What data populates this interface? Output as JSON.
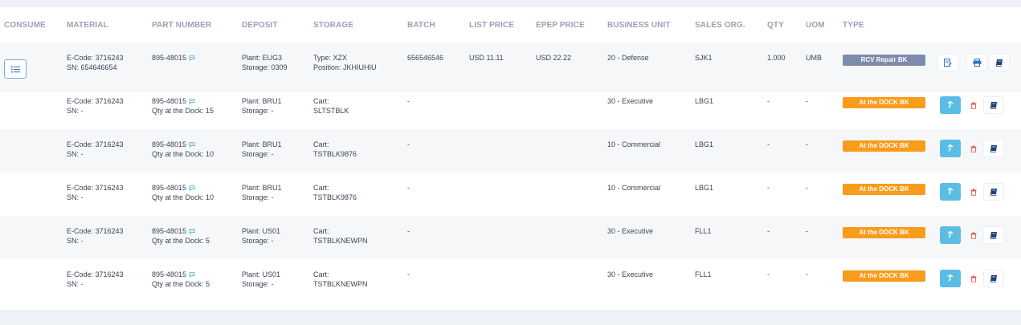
{
  "headers": {
    "consume": "CONSUME",
    "material": "MATERIAL",
    "part_number": "PART NUMBER",
    "deposit": "DEPOSIT",
    "storage": "STORAGE",
    "batch": "BATCH",
    "list_price": "LIST PRICE",
    "epep_price": "EPEP PRICE",
    "business_unit": "BUSINESS UNIT",
    "sales_org": "SALES ORG.",
    "qty": "QTY",
    "uom": "UOM",
    "type": "TYPE"
  },
  "colors": {
    "header_text": "#9aa3b2",
    "badge_grey": "#7d8cac",
    "badge_orange": "#f99b1b",
    "action_blue": "#5bbde3",
    "link_blue": "#3fa7dd",
    "delete_red": "#e25b5b"
  },
  "rows": [
    {
      "material_1": "E-Code: 3716243",
      "material_2": "SN: 654646654",
      "part_1": "895-48015",
      "part_2": "",
      "deposit_1": "Plant: EUG3",
      "deposit_2": "Storage: 0309",
      "storage_1": "Type: XZX",
      "storage_2": "Position: JKHIUHIU",
      "batch": "656546546",
      "list_price": "USD 11.11",
      "epep_price": "USD 22.22",
      "business_unit": "20 - Defense",
      "sales_org": "SJK1",
      "qty": "1.000",
      "uom": "UMB",
      "type": "RCV Repair BK",
      "icons": [
        "consume-list-icon",
        "edit-document-icon",
        "print-icon",
        "book-icon"
      ]
    },
    {
      "material_1": "E-Code: 3716243",
      "material_2": "SN: -",
      "part_1": "895-48015",
      "part_2": "Qty at the Dock: 15",
      "deposit_1": "Plant: BRU1",
      "deposit_2": "Storage: -",
      "storage_1": "Cart:",
      "storage_2": "SLTSTBLK",
      "batch": "-",
      "list_price": "",
      "epep_price": "",
      "business_unit": "30 - Executive",
      "sales_org": "LBG1",
      "qty": "-",
      "uom": "-",
      "type": "At the DOCK BK",
      "icons": [
        "move-icon",
        "trash-icon",
        "book-icon"
      ]
    },
    {
      "material_1": "E-Code: 3716243",
      "material_2": "SN: -",
      "part_1": "895-48015",
      "part_2": "Qty at the Dock: 10",
      "deposit_1": "Plant: BRU1",
      "deposit_2": "Storage: -",
      "storage_1": "Cart:",
      "storage_2": "TSTBLK9876",
      "batch": "-",
      "list_price": "",
      "epep_price": "",
      "business_unit": "10 - Commercial",
      "sales_org": "LBG1",
      "qty": "-",
      "uom": "-",
      "type": "At the DOCK BK",
      "icons": [
        "move-icon",
        "trash-icon",
        "book-icon"
      ]
    },
    {
      "material_1": "E-Code: 3716243",
      "material_2": "SN: -",
      "part_1": "895-48015",
      "part_2": "Qty at the Dock: 10",
      "deposit_1": "Plant: BRU1",
      "deposit_2": "Storage: -",
      "storage_1": "Cart:",
      "storage_2": "TSTBLK9876",
      "batch": "-",
      "list_price": "",
      "epep_price": "",
      "business_unit": "10 - Commercial",
      "sales_org": "LBG1",
      "qty": "-",
      "uom": "-",
      "type": "At the DOCK BK",
      "icons": [
        "move-icon",
        "trash-icon",
        "book-icon"
      ]
    },
    {
      "material_1": "E-Code: 3716243",
      "material_2": "SN: -",
      "part_1": "895-48015",
      "part_2": "Qty at the Dock: 5",
      "deposit_1": "Plant: US01",
      "deposit_2": "Storage: -",
      "storage_1": "Cart:",
      "storage_2": "TSTBLKNEWPN",
      "batch": "-",
      "list_price": "",
      "epep_price": "",
      "business_unit": "30 - Executive",
      "sales_org": "FLL1",
      "qty": "-",
      "uom": "-",
      "type": "At the DOCK BK",
      "icons": [
        "move-icon",
        "trash-icon",
        "book-icon"
      ]
    },
    {
      "material_1": "E-Code: 3716243",
      "material_2": "SN: -",
      "part_1": "895-48015",
      "part_2": "Qty at the Dock: 5",
      "deposit_1": "Plant: US01",
      "deposit_2": "Storage: -",
      "storage_1": "Cart:",
      "storage_2": "TSTBLKNEWPN",
      "batch": "-",
      "list_price": "",
      "epep_price": "",
      "business_unit": "30 - Executive",
      "sales_org": "FLL1",
      "qty": "-",
      "uom": "-",
      "type": "At the DOCK BK",
      "icons": [
        "move-icon",
        "trash-icon",
        "book-icon"
      ]
    }
  ]
}
